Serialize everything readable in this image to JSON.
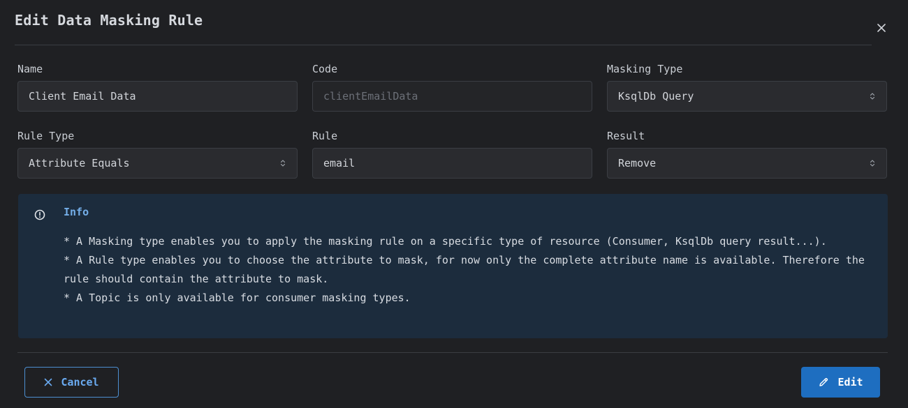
{
  "dialog": {
    "title": "Edit Data Masking Rule"
  },
  "fields": {
    "name": {
      "label": "Name",
      "value": "Client Email Data"
    },
    "code": {
      "label": "Code",
      "placeholder": "clientEmailData"
    },
    "masking_type": {
      "label": "Masking Type",
      "value": "KsqlDb Query"
    },
    "rule_type": {
      "label": "Rule Type",
      "value": "Attribute Equals"
    },
    "rule": {
      "label": "Rule",
      "value": "email"
    },
    "result": {
      "label": "Result",
      "value": "Remove"
    }
  },
  "info": {
    "title": "Info",
    "lines": [
      "* A Masking type enables you to apply the masking rule on a specific type of resource (Consumer, KsqlDb query result...).",
      "* A Rule type enables you to choose the attribute to mask, for now only the complete attribute name is available. Therefore the rule should contain the attribute to mask.",
      "* A Topic is only available for consumer masking types."
    ]
  },
  "actions": {
    "cancel_label": "Cancel",
    "edit_label": "Edit"
  },
  "colors": {
    "background": "#1f2023",
    "info_background": "#1c2c3d",
    "accent": "#1e6ec0",
    "accent_text": "#6aaaf0"
  },
  "icons": {
    "close": "close-icon",
    "info": "info-circle-icon",
    "select": "chevron-updown-icon",
    "cancel": "x-icon",
    "edit": "pencil-icon"
  }
}
